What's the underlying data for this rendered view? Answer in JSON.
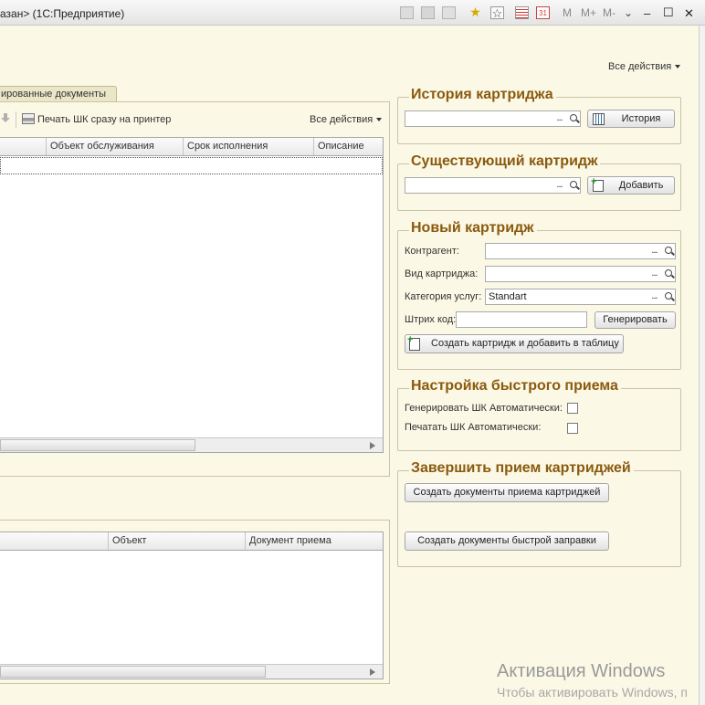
{
  "window": {
    "title": "азан> (1С:Предприятие)",
    "toolbar_text": {
      "m": "M",
      "m_plus": "M+",
      "m_minus": "M-"
    },
    "controls": {
      "minimize": "–",
      "maximize": "☐",
      "close": "✕"
    }
  },
  "top_actions_label": "Все действия",
  "upper_panel": {
    "tab_label": "ированные документы",
    "print_button_label": "Печать ШК сразу на принтер",
    "all_actions_label": "Все действия",
    "columns": [
      "Объект обслуживания",
      "Срок исполнения",
      "Описание"
    ]
  },
  "lower_panel": {
    "columns": [
      "Объект",
      "Документ приема"
    ]
  },
  "history_group": {
    "title": "История картриджа",
    "field_value": "",
    "button_label": "История"
  },
  "existing_group": {
    "title": "Существующий картридж",
    "field_value": "",
    "button_label": "Добавить"
  },
  "new_group": {
    "title": "Новый картридж",
    "contractor_label": "Контрагент:",
    "contractor_value": "",
    "type_label": "Вид картриджа:",
    "type_value": "",
    "category_label": "Категория услуг:",
    "category_value": "Standart",
    "barcode_label": "Штрих код:",
    "barcode_value": "",
    "generate_label": "Генерировать",
    "create_add_label": "Создать картридж и добавить в таблицу"
  },
  "settings_group": {
    "title": "Настройка быстрого приема",
    "auto_generate_label": "Генерировать ШК Автоматически:",
    "auto_print_label": "Печатать ШК Автоматически:"
  },
  "finish_group": {
    "title": "Завершить прием картриджей",
    "create_receipt_docs_label": "Создать документы приема картриджей",
    "create_refill_docs_label": "Создать документы быстрой заправки"
  },
  "watermark": {
    "line1": "Активация Windows",
    "line2": "Чтобы активировать Windows, п"
  },
  "colors": {
    "background": "#fbf8e6",
    "group_title": "#8a5a0e",
    "border": "#c8c4a8"
  }
}
